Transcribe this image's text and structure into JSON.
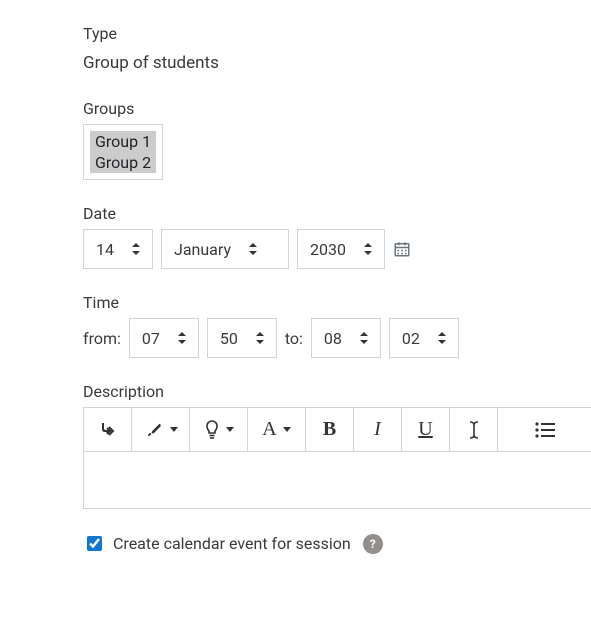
{
  "type": {
    "label": "Type",
    "value": "Group of students"
  },
  "groups": {
    "label": "Groups",
    "items": [
      "Group 1",
      "Group 2"
    ]
  },
  "date": {
    "label": "Date",
    "day": "14",
    "month": "January",
    "year": "2030"
  },
  "time": {
    "label": "Time",
    "from_label": "from:",
    "to_label": "to:",
    "from_hour": "07",
    "from_min": "50",
    "to_hour": "08",
    "to_min": "02"
  },
  "description": {
    "label": "Description"
  },
  "toolbar": {
    "bold": "B",
    "italic": "I",
    "underline": "U",
    "font": "A"
  },
  "calendar_event": {
    "label": "Create calendar event for session",
    "checked": true,
    "help": "?"
  }
}
